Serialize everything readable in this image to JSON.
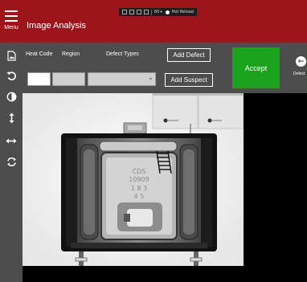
{
  "app": {
    "title": "Image Analysis"
  },
  "menu": {
    "label": "Menu"
  },
  "debug_toolbar": {
    "fps": "60+",
    "hot_reload_label": "Hot Reload"
  },
  "toolbar": {
    "heat_code_label": "Heat Code",
    "region_label": "Region",
    "defect_types_label": "Defect Types",
    "heat_code_value": "",
    "region_value": "",
    "defect_types_value": "",
    "add_defect_label": "Add Defect",
    "add_suspect_label": "Add Suspect",
    "accept_label": "Accept",
    "next_label": "Defect"
  },
  "sidebar": {
    "items": [
      {
        "icon": "image-file-icon"
      },
      {
        "icon": "rotate-left-icon"
      },
      {
        "icon": "contrast-icon"
      },
      {
        "icon": "vertical-flip-icon"
      },
      {
        "icon": "horizontal-flip-icon"
      },
      {
        "icon": "refresh-icon"
      }
    ]
  },
  "image": {
    "engraving_lines": [
      "CDS",
      "10909",
      "1 8 3",
      "4 5"
    ]
  },
  "colors": {
    "header": "#9e141b",
    "panel": "#4d4d4d",
    "accept": "#1aa31d"
  }
}
